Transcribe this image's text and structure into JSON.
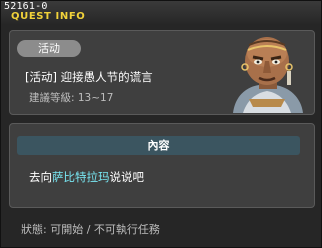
{
  "window": {
    "quest_id": "52161-0",
    "title": "QUEST INFO"
  },
  "quest": {
    "tag": "活动",
    "name": "[活动] 迎接愚人节的谎言",
    "recommended_level": "建議等級: 13~17",
    "npc_icon": "tribal-elder-npc-portrait"
  },
  "content": {
    "header": "內容",
    "text_before": "去向",
    "npc_name": "萨比特拉玛",
    "text_after": "说说吧"
  },
  "status": {
    "text": "狀態: 可開始 / 不可執行任務"
  },
  "colors": {
    "title": "#f1d23a",
    "npc_link": "#78e6f2",
    "panel": "#3f3f3f",
    "content_header": "#3b5560"
  }
}
